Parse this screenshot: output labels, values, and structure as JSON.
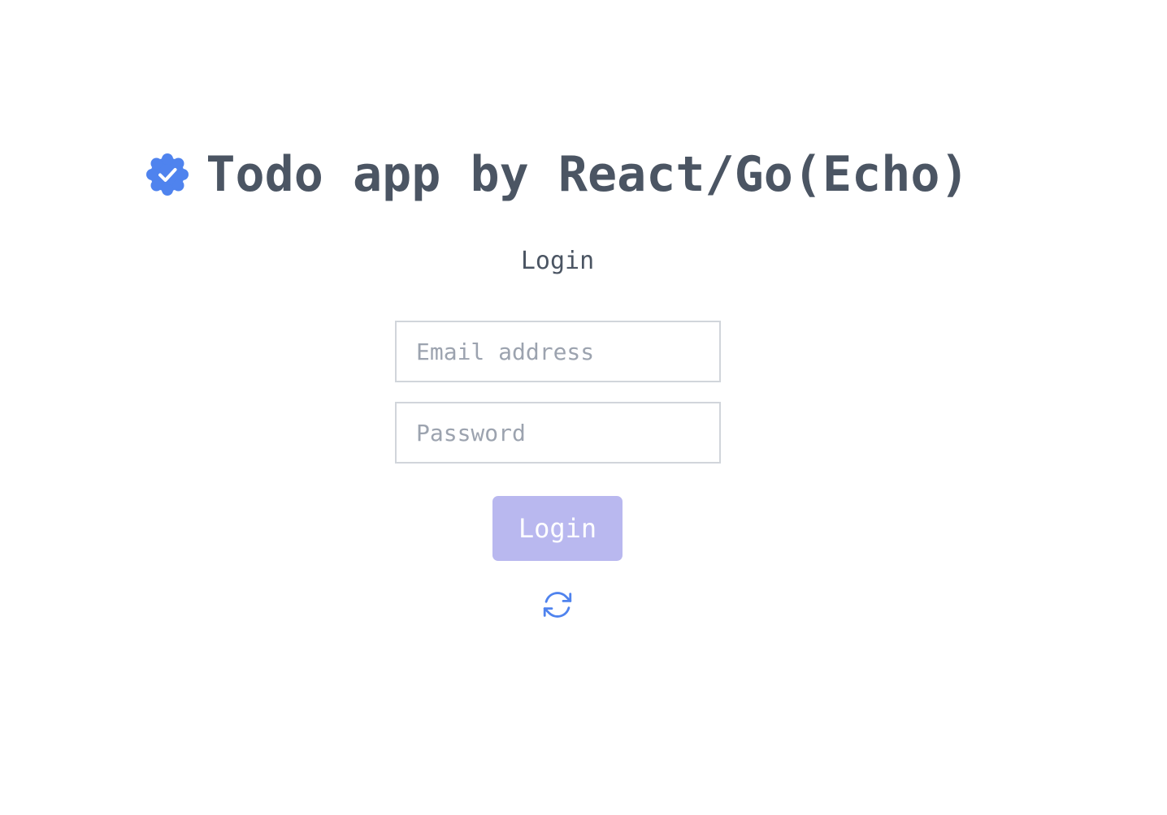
{
  "header": {
    "title": "Todo app by React/Go(Echo)",
    "logo_icon": "badge-check-icon",
    "logo_color": "#4f83ee"
  },
  "form": {
    "heading": "Login",
    "email_placeholder": "Email address",
    "email_value": "",
    "password_placeholder": "Password",
    "password_value": "",
    "submit_label": "Login",
    "submit_color": "#b9b8ef",
    "toggle_icon": "arrow-path-icon"
  }
}
